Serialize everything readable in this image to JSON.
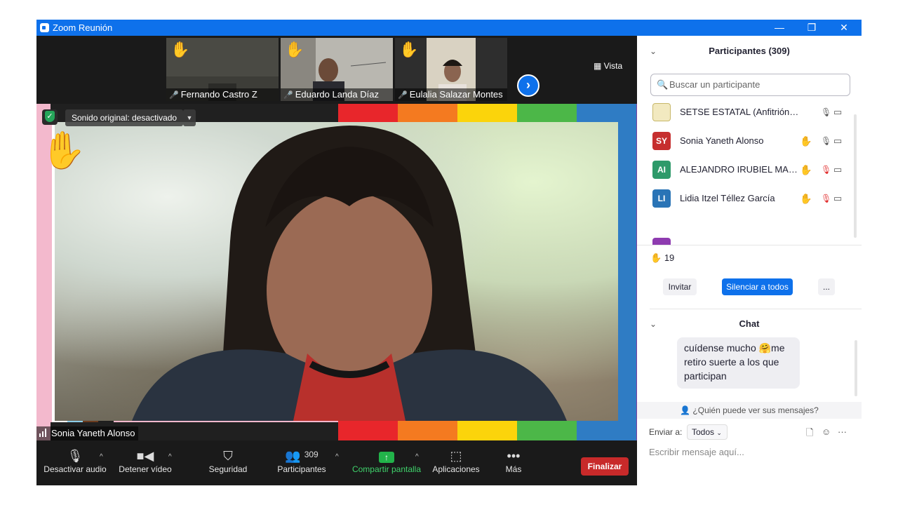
{
  "window": {
    "title": "Zoom Reunión",
    "controls": [
      "—",
      "❐",
      "✕"
    ]
  },
  "thumbnails": [
    {
      "name": "Fernando Castro Z",
      "hand": "✋",
      "mic_muted": true
    },
    {
      "name": "Eduardo Landa Díaz",
      "hand": "✋",
      "mic_muted": true
    },
    {
      "name": "Eulalia Salazar Montes",
      "hand": "✋",
      "mic_muted": true
    }
  ],
  "gallery": {
    "next_icon": "›",
    "view_label": "Vista",
    "view_icon": "grid-icon"
  },
  "main_video": {
    "sound_label": "Sonido original: desactivado",
    "sound_caret": "▼",
    "hand": "✋",
    "speaker_name": "Sonia Yaneth Alonso",
    "rainbow_colors": [
      "#e8262b",
      "#f47a20",
      "#fbd40b",
      "#4cb748",
      "#2f7cc4",
      "#7b3fa0"
    ]
  },
  "toolbar": {
    "mute_label": "Desactivar audio",
    "video_label": "Detener vídeo",
    "security_label": "Seguridad",
    "participants_label": "Participantes",
    "participants_count": "309",
    "share_label": "Compartir pantalla",
    "apps_label": "Aplicaciones",
    "more_label": "Más",
    "end_label": "Finalizar",
    "caret": "^"
  },
  "participants_panel": {
    "title": "Participantes (309)",
    "search_placeholder": "Buscar un participante",
    "participants": [
      {
        "initials": "",
        "name": "SETSE ESTATAL (Anfitrión, yo)",
        "color": "#f2e9c0",
        "hand": "",
        "mic_muted": false
      },
      {
        "initials": "SY",
        "name": "Sonia Yaneth Alonso",
        "color": "#c62f2f",
        "hand": "✋",
        "mic_muted": false
      },
      {
        "initials": "AI",
        "name": "ALEJANDRO IRUBIEL MART...",
        "color": "#2e9a6a",
        "hand": "✋",
        "mic_muted": true
      },
      {
        "initials": "LI",
        "name": "Lidia Itzel Téllez García",
        "color": "#2a74b6",
        "hand": "✋",
        "mic_muted": true
      }
    ],
    "hand_count": "19",
    "invite_label": "Invitar",
    "mute_all_label": "Silenciar a todos",
    "more_label": "..."
  },
  "chat": {
    "title": "Chat",
    "message_line1": "cuídense mucho 🤗me",
    "message_line2": "retiro suerte a los que",
    "message_line3": "participan",
    "who_sees": "¿Quién puede ver sus mensajes?",
    "send_to_label": "Enviar a:",
    "recipient": "Todos",
    "input_placeholder": "Escribir mensaje aquí..."
  }
}
